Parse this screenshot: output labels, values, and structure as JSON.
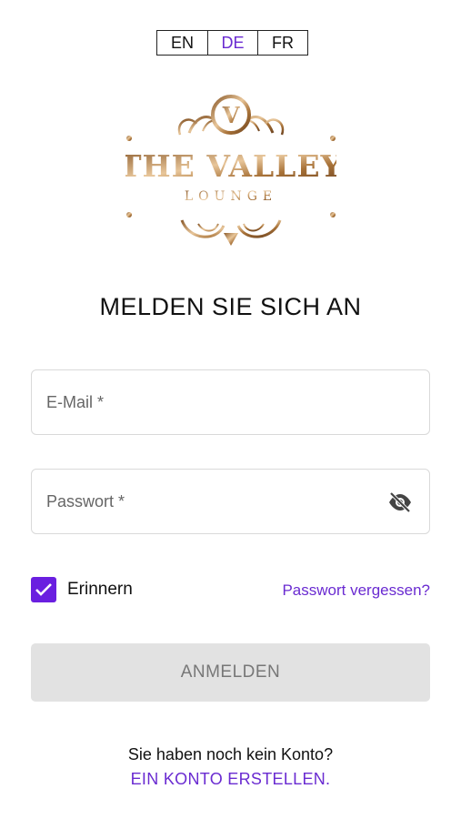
{
  "language_switcher": {
    "options": [
      "EN",
      "DE",
      "FR"
    ],
    "selected": "DE"
  },
  "logo": {
    "monogram": "V",
    "name": "THE VALLEY",
    "subtitle": "LOUNGE"
  },
  "heading": "MELDEN SIE SICH AN",
  "form": {
    "email_placeholder": "E-Mail *",
    "email_value": "",
    "password_placeholder": "Passwort *",
    "password_value": "",
    "password_toggle_icon": "eye-off-icon",
    "remember_label": "Erinnern",
    "remember_checked": true,
    "forgot_password": "Passwort vergessen?",
    "submit_label": "ANMELDEN"
  },
  "footer": {
    "no_account_text": "Sie haben noch kein Konto?",
    "create_account_link": "EIN KONTO ERSTELLEN."
  },
  "colors": {
    "accent": "#6a2bd1",
    "checkbox": "#6a1fe0",
    "button_disabled_bg": "#e2e2e2",
    "logo_gold": "#b88a4e"
  }
}
